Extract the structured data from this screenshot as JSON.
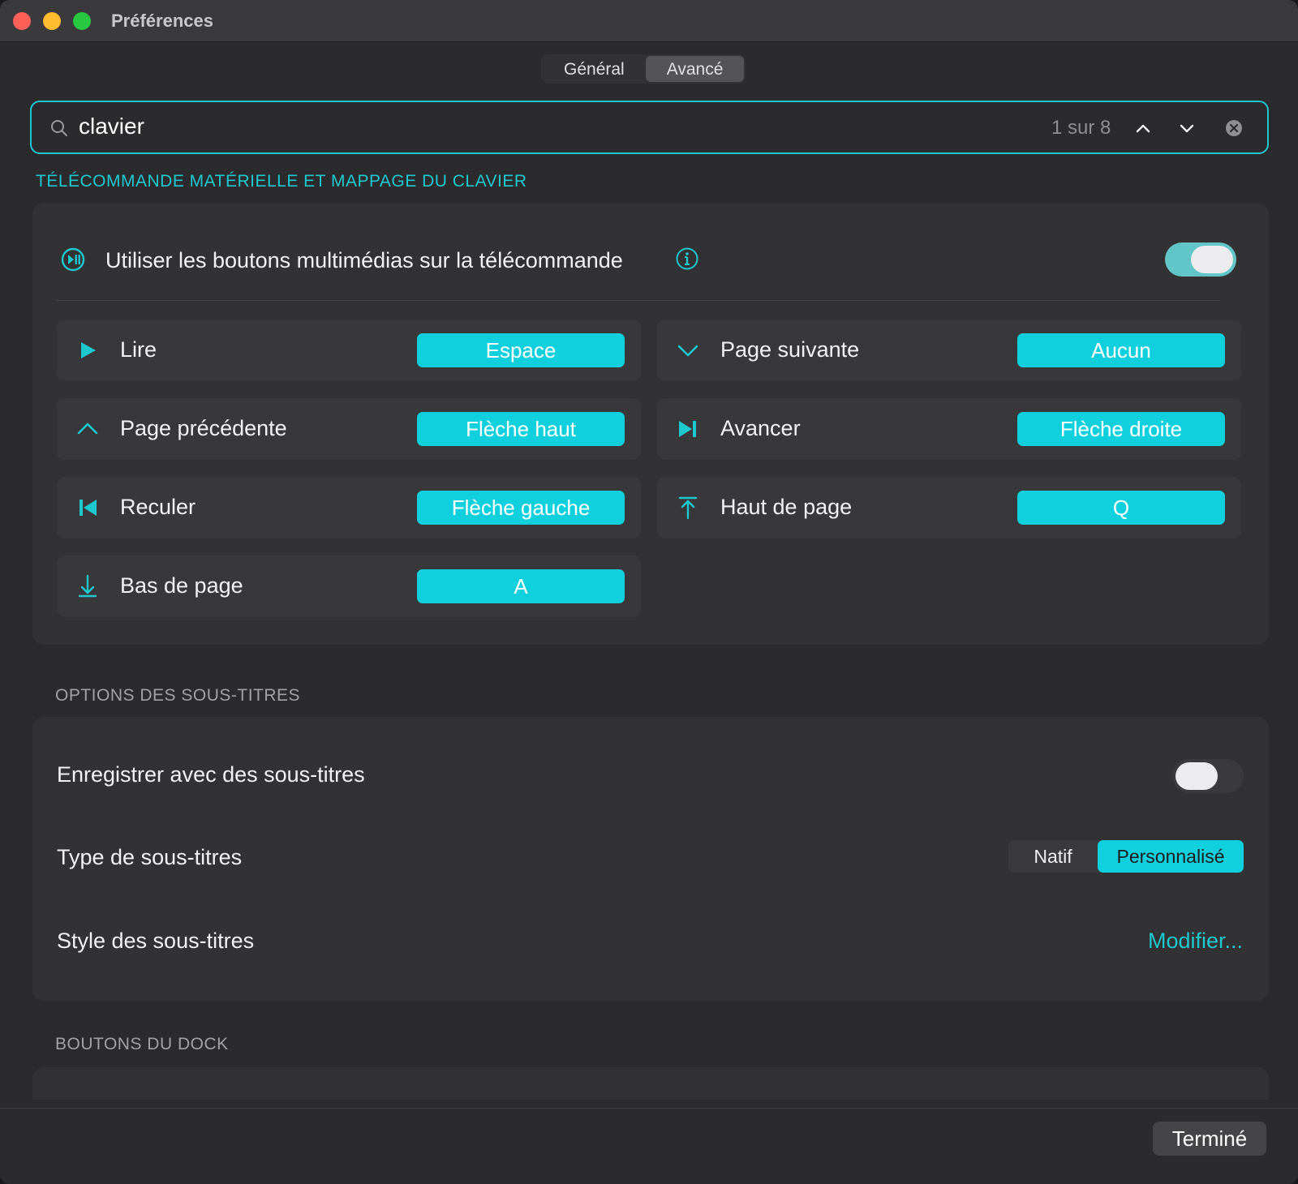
{
  "window": {
    "title": "Préférences"
  },
  "tabs": [
    {
      "label": "Général",
      "active": false
    },
    {
      "label": "Avancé",
      "active": true
    }
  ],
  "search": {
    "value": "clavier",
    "count": "1 sur 8"
  },
  "remote_section": {
    "title": "TÉLÉCOMMANDE MATÉRIELLE ET MAPPAGE DU CLAVIER",
    "media_buttons_label": "Utiliser les boutons multimédias sur la télécommande",
    "media_buttons_on": true,
    "mappings": [
      {
        "icon": "play-icon",
        "label": "Lire",
        "key": "Espace"
      },
      {
        "icon": "chevron-down-icon",
        "label": "Page suivante",
        "key": "Aucun"
      },
      {
        "icon": "chevron-up-icon",
        "label": "Page précédente",
        "key": "Flèche haut"
      },
      {
        "icon": "skip-forward-icon",
        "label": "Avancer",
        "key": "Flèche droite"
      },
      {
        "icon": "skip-back-icon",
        "label": "Reculer",
        "key": "Flèche gauche"
      },
      {
        "icon": "arrow-to-top-icon",
        "label": "Haut de page",
        "key": "Q"
      },
      {
        "icon": "arrow-to-bottom-icon",
        "label": "Bas de page",
        "key": "A"
      }
    ]
  },
  "subtitles_section": {
    "title": "OPTIONS DES SOUS-TITRES",
    "record_label": "Enregistrer avec des sous-titres",
    "record_on": false,
    "type_label": "Type de sous-titres",
    "type_options": [
      "Natif",
      "Personnalisé"
    ],
    "type_selected": "Personnalisé",
    "style_label": "Style des sous-titres",
    "style_link": "Modifier..."
  },
  "dock_section": {
    "title": "BOUTONS DU DOCK"
  },
  "footer": {
    "done_label": "Terminé"
  },
  "colors": {
    "accent": "#1ec8cf",
    "key_button": "#0fd0dc",
    "background": "#2b2b2d",
    "panel": "#323234"
  }
}
